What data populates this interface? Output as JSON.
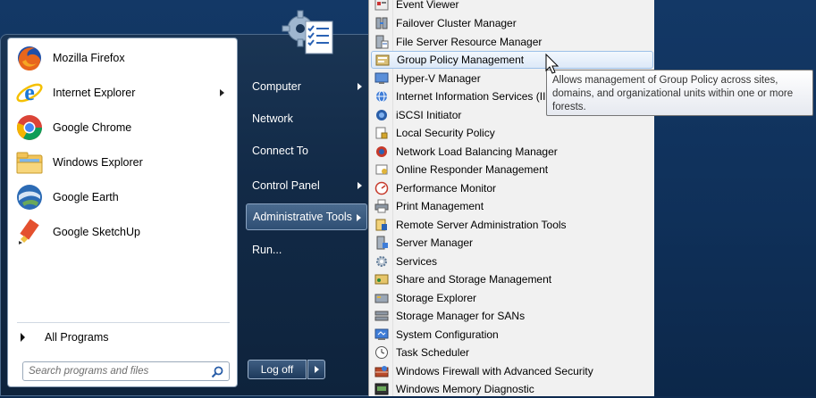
{
  "pinned_programs": [
    {
      "label": "Mozilla Firefox",
      "icon": "firefox-icon"
    },
    {
      "label": "Internet Explorer",
      "icon": "internet-explorer-icon",
      "has_submenu": true
    },
    {
      "label": "Google Chrome",
      "icon": "chrome-icon"
    },
    {
      "label": "Windows Explorer",
      "icon": "folder-icon"
    },
    {
      "label": "Google Earth",
      "icon": "google-earth-icon"
    },
    {
      "label": "Google SketchUp",
      "icon": "sketchup-icon"
    }
  ],
  "all_programs_label": "All Programs",
  "search": {
    "placeholder": "Search programs and files"
  },
  "right_column": {
    "items": [
      {
        "label": "Computer",
        "has_submenu": true
      },
      {
        "label": "Network",
        "has_submenu": false
      },
      {
        "label": "Connect To",
        "has_submenu": false
      },
      {
        "label": "Control Panel",
        "has_submenu": true
      },
      {
        "label": "Administrative Tools",
        "has_submenu": true,
        "highlighted": true
      },
      {
        "label": "Run...",
        "has_submenu": false
      }
    ],
    "logoff_label": "Log off"
  },
  "admin_tools_submenu": [
    {
      "label": "Event Viewer",
      "icon": "event-viewer-icon"
    },
    {
      "label": "Failover Cluster Manager",
      "icon": "cluster-icon"
    },
    {
      "label": "File Server Resource Manager",
      "icon": "file-server-icon"
    },
    {
      "label": "Group Policy Management",
      "icon": "group-policy-icon",
      "highlighted": true
    },
    {
      "label": "Hyper-V Manager",
      "icon": "hyperv-icon"
    },
    {
      "label": "Internet Information Services (II",
      "icon": "iis-icon"
    },
    {
      "label": "iSCSI Initiator",
      "icon": "iscsi-icon"
    },
    {
      "label": "Local Security Policy",
      "icon": "security-policy-icon"
    },
    {
      "label": "Network Load Balancing Manager",
      "icon": "network-load-icon"
    },
    {
      "label": "Online Responder Management",
      "icon": "online-responder-icon"
    },
    {
      "label": "Performance Monitor",
      "icon": "performance-icon"
    },
    {
      "label": "Print Management",
      "icon": "printer-icon"
    },
    {
      "label": "Remote Server Administration Tools",
      "icon": "remote-tools-icon"
    },
    {
      "label": "Server Manager",
      "icon": "server-icon"
    },
    {
      "label": "Services",
      "icon": "services-gear-icon"
    },
    {
      "label": "Share and Storage Management",
      "icon": "share-storage-icon"
    },
    {
      "label": "Storage Explorer",
      "icon": "storage-explorer-icon"
    },
    {
      "label": "Storage Manager for SANs",
      "icon": "san-icon"
    },
    {
      "label": "System Configuration",
      "icon": "system-config-icon"
    },
    {
      "label": "Task Scheduler",
      "icon": "clock-icon"
    },
    {
      "label": "Windows Firewall with Advanced Security",
      "icon": "firewall-icon"
    },
    {
      "label": "Windows Memory Diagnostic",
      "icon": "memory-diagnostic-icon"
    }
  ],
  "tooltip": {
    "text": "Allows management of Group Policy across sites, domains, and organizational units within one or more forests."
  },
  "colors": {
    "submenu_highlight_border": "#9cc0e8",
    "menu_dark": "#122a47",
    "admin_tools_highlight": "#3c5d83"
  }
}
